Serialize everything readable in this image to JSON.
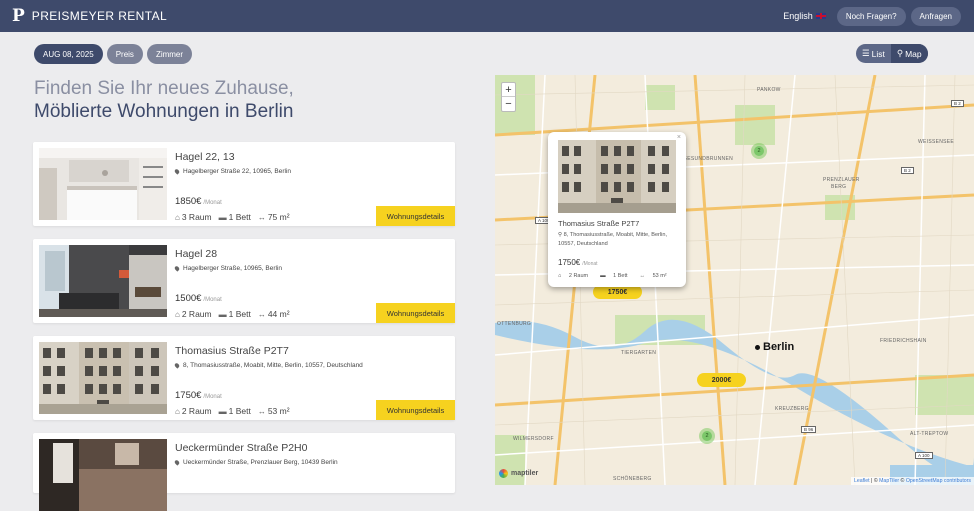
{
  "topbar": {
    "logo_mark": "P",
    "brand": "PREISMEYER RENTAL",
    "language": "English",
    "questions": "Noch Fragen?",
    "request": "Anfragen"
  },
  "filters": {
    "date": "AUG 08, 2025",
    "price": "Preis",
    "rooms": "Zimmer"
  },
  "view_toggle": {
    "list": "List",
    "map": "Map",
    "active": "map"
  },
  "heading": {
    "line1": "Finden Sie Ihr neues Zuhause,",
    "line2": "Möblierte Wohnungen in Berlin"
  },
  "listings": [
    {
      "title": "Hagel 22, 13",
      "address": "Hagelberger Straße 22, 10965, Berlin",
      "price": "1850€",
      "per": "/Monat",
      "rooms": "3 Raum",
      "beds": "1 Bett",
      "size": "75 m²",
      "button": "Wohnungsdetails"
    },
    {
      "title": "Hagel 28",
      "address": "Hagelberger Straße, 10965, Berlin",
      "price": "1500€",
      "per": "/Monat",
      "rooms": "2 Raum",
      "beds": "1 Bett",
      "size": "44 m²",
      "button": "Wohnungsdetails"
    },
    {
      "title": "Thomasius Straße P2T7",
      "address": "8, Thomasiusstraße, Moabit, Mitte, Berlin, 10557, Deutschland",
      "price": "1750€",
      "per": "/Monat",
      "rooms": "2 Raum",
      "beds": "1 Bett",
      "size": "53 m²",
      "button": "Wohnungsdetails"
    },
    {
      "title": "Ueckermünder Straße P2H0",
      "address": "Ueckermünder Straße, Prenzlauer Berg, 10439 Berlin"
    }
  ],
  "map": {
    "zoom_in": "+",
    "zoom_out": "−",
    "popup": {
      "close": "×",
      "title": "Thomasius Straße P2T7",
      "address": "8, Thomasiusstraße, Moabit, Mitte, Berlin, 10557, Deutschland",
      "price": "1750€",
      "per": "/Monat",
      "rooms": "2 Raum",
      "beds": "1 Bett",
      "size": "53 m²"
    },
    "price_markers": [
      "1750€",
      "2000€"
    ],
    "clusters": [
      "2",
      "2"
    ],
    "labels": {
      "pankow": "PANKOW",
      "gesundbrunnen": "GESUNDBRUNNEN",
      "weissensee": "WEISSENSEE",
      "prenzlauer": "PRENZLAUER",
      "berg": "BERG",
      "ottenburg": "OTTENBURG",
      "tiergarten": "TIERGARTEN",
      "friedrichshain": "FRIEDRICHSHAIN",
      "kreuzberg": "KREUZBERG",
      "wilmersdorf": "WILMERSDORF",
      "schoeneberg": "SCHÖNEBERG",
      "alt_treptow": "ALT-TREPTOW"
    },
    "city": "Berlin",
    "shields": [
      "B 2",
      "B 2",
      "A 100",
      "B 96",
      "A 100"
    ],
    "maptiler": "maptiler",
    "attribution": {
      "leaflet": "Leaflet",
      "sep1": " | © ",
      "maptiler": "MapTiler",
      "sep2": " © ",
      "osm": "OpenStreetMap contributors"
    }
  },
  "colors": {
    "navbar": "#3e4a6b",
    "accent": "#f6d21f",
    "cluster": "#7cc76a"
  }
}
